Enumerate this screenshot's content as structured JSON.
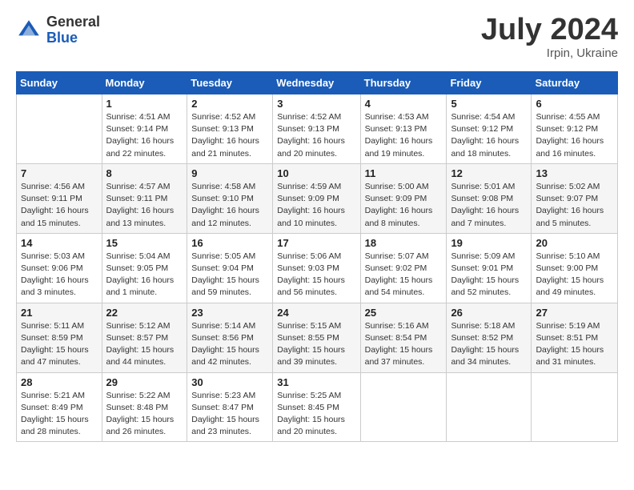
{
  "header": {
    "logo_general": "General",
    "logo_blue": "Blue",
    "title": "July 2024",
    "location": "Irpin, Ukraine"
  },
  "columns": [
    "Sunday",
    "Monday",
    "Tuesday",
    "Wednesday",
    "Thursday",
    "Friday",
    "Saturday"
  ],
  "weeks": [
    [
      {
        "day": "",
        "sunrise": "",
        "sunset": "",
        "daylight": ""
      },
      {
        "day": "1",
        "sunrise": "Sunrise: 4:51 AM",
        "sunset": "Sunset: 9:14 PM",
        "daylight": "Daylight: 16 hours and 22 minutes."
      },
      {
        "day": "2",
        "sunrise": "Sunrise: 4:52 AM",
        "sunset": "Sunset: 9:13 PM",
        "daylight": "Daylight: 16 hours and 21 minutes."
      },
      {
        "day": "3",
        "sunrise": "Sunrise: 4:52 AM",
        "sunset": "Sunset: 9:13 PM",
        "daylight": "Daylight: 16 hours and 20 minutes."
      },
      {
        "day": "4",
        "sunrise": "Sunrise: 4:53 AM",
        "sunset": "Sunset: 9:13 PM",
        "daylight": "Daylight: 16 hours and 19 minutes."
      },
      {
        "day": "5",
        "sunrise": "Sunrise: 4:54 AM",
        "sunset": "Sunset: 9:12 PM",
        "daylight": "Daylight: 16 hours and 18 minutes."
      },
      {
        "day": "6",
        "sunrise": "Sunrise: 4:55 AM",
        "sunset": "Sunset: 9:12 PM",
        "daylight": "Daylight: 16 hours and 16 minutes."
      }
    ],
    [
      {
        "day": "7",
        "sunrise": "Sunrise: 4:56 AM",
        "sunset": "Sunset: 9:11 PM",
        "daylight": "Daylight: 16 hours and 15 minutes."
      },
      {
        "day": "8",
        "sunrise": "Sunrise: 4:57 AM",
        "sunset": "Sunset: 9:11 PM",
        "daylight": "Daylight: 16 hours and 13 minutes."
      },
      {
        "day": "9",
        "sunrise": "Sunrise: 4:58 AM",
        "sunset": "Sunset: 9:10 PM",
        "daylight": "Daylight: 16 hours and 12 minutes."
      },
      {
        "day": "10",
        "sunrise": "Sunrise: 4:59 AM",
        "sunset": "Sunset: 9:09 PM",
        "daylight": "Daylight: 16 hours and 10 minutes."
      },
      {
        "day": "11",
        "sunrise": "Sunrise: 5:00 AM",
        "sunset": "Sunset: 9:09 PM",
        "daylight": "Daylight: 16 hours and 8 minutes."
      },
      {
        "day": "12",
        "sunrise": "Sunrise: 5:01 AM",
        "sunset": "Sunset: 9:08 PM",
        "daylight": "Daylight: 16 hours and 7 minutes."
      },
      {
        "day": "13",
        "sunrise": "Sunrise: 5:02 AM",
        "sunset": "Sunset: 9:07 PM",
        "daylight": "Daylight: 16 hours and 5 minutes."
      }
    ],
    [
      {
        "day": "14",
        "sunrise": "Sunrise: 5:03 AM",
        "sunset": "Sunset: 9:06 PM",
        "daylight": "Daylight: 16 hours and 3 minutes."
      },
      {
        "day": "15",
        "sunrise": "Sunrise: 5:04 AM",
        "sunset": "Sunset: 9:05 PM",
        "daylight": "Daylight: 16 hours and 1 minute."
      },
      {
        "day": "16",
        "sunrise": "Sunrise: 5:05 AM",
        "sunset": "Sunset: 9:04 PM",
        "daylight": "Daylight: 15 hours and 59 minutes."
      },
      {
        "day": "17",
        "sunrise": "Sunrise: 5:06 AM",
        "sunset": "Sunset: 9:03 PM",
        "daylight": "Daylight: 15 hours and 56 minutes."
      },
      {
        "day": "18",
        "sunrise": "Sunrise: 5:07 AM",
        "sunset": "Sunset: 9:02 PM",
        "daylight": "Daylight: 15 hours and 54 minutes."
      },
      {
        "day": "19",
        "sunrise": "Sunrise: 5:09 AM",
        "sunset": "Sunset: 9:01 PM",
        "daylight": "Daylight: 15 hours and 52 minutes."
      },
      {
        "day": "20",
        "sunrise": "Sunrise: 5:10 AM",
        "sunset": "Sunset: 9:00 PM",
        "daylight": "Daylight: 15 hours and 49 minutes."
      }
    ],
    [
      {
        "day": "21",
        "sunrise": "Sunrise: 5:11 AM",
        "sunset": "Sunset: 8:59 PM",
        "daylight": "Daylight: 15 hours and 47 minutes."
      },
      {
        "day": "22",
        "sunrise": "Sunrise: 5:12 AM",
        "sunset": "Sunset: 8:57 PM",
        "daylight": "Daylight: 15 hours and 44 minutes."
      },
      {
        "day": "23",
        "sunrise": "Sunrise: 5:14 AM",
        "sunset": "Sunset: 8:56 PM",
        "daylight": "Daylight: 15 hours and 42 minutes."
      },
      {
        "day": "24",
        "sunrise": "Sunrise: 5:15 AM",
        "sunset": "Sunset: 8:55 PM",
        "daylight": "Daylight: 15 hours and 39 minutes."
      },
      {
        "day": "25",
        "sunrise": "Sunrise: 5:16 AM",
        "sunset": "Sunset: 8:54 PM",
        "daylight": "Daylight: 15 hours and 37 minutes."
      },
      {
        "day": "26",
        "sunrise": "Sunrise: 5:18 AM",
        "sunset": "Sunset: 8:52 PM",
        "daylight": "Daylight: 15 hours and 34 minutes."
      },
      {
        "day": "27",
        "sunrise": "Sunrise: 5:19 AM",
        "sunset": "Sunset: 8:51 PM",
        "daylight": "Daylight: 15 hours and 31 minutes."
      }
    ],
    [
      {
        "day": "28",
        "sunrise": "Sunrise: 5:21 AM",
        "sunset": "Sunset: 8:49 PM",
        "daylight": "Daylight: 15 hours and 28 minutes."
      },
      {
        "day": "29",
        "sunrise": "Sunrise: 5:22 AM",
        "sunset": "Sunset: 8:48 PM",
        "daylight": "Daylight: 15 hours and 26 minutes."
      },
      {
        "day": "30",
        "sunrise": "Sunrise: 5:23 AM",
        "sunset": "Sunset: 8:47 PM",
        "daylight": "Daylight: 15 hours and 23 minutes."
      },
      {
        "day": "31",
        "sunrise": "Sunrise: 5:25 AM",
        "sunset": "Sunset: 8:45 PM",
        "daylight": "Daylight: 15 hours and 20 minutes."
      },
      {
        "day": "",
        "sunrise": "",
        "sunset": "",
        "daylight": ""
      },
      {
        "day": "",
        "sunrise": "",
        "sunset": "",
        "daylight": ""
      },
      {
        "day": "",
        "sunrise": "",
        "sunset": "",
        "daylight": ""
      }
    ]
  ]
}
